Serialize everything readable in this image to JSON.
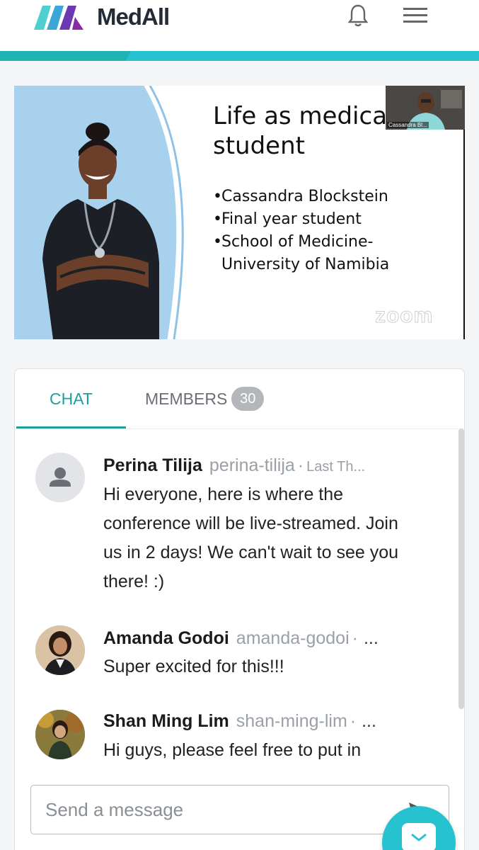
{
  "header": {
    "brand": "MedAll",
    "notifications_icon": "bell-icon",
    "menu_icon": "hamburger-menu-icon",
    "accent_color": "#27c2cf"
  },
  "video": {
    "slide_title": "Life as medical student",
    "slide_bullets": [
      "Cassandra Blockstein",
      "Final year student",
      "School of Medicine-",
      "University of Namibia"
    ],
    "pip_name": "Cassandra Bl...",
    "watermark": "zoom"
  },
  "tabs": {
    "chat_label": "CHAT",
    "members_label": "MEMBERS",
    "members_count": "30"
  },
  "messages": [
    {
      "name": "Perina Tilija",
      "handle": "perina-tilija",
      "time": "Last Th...",
      "text": "Hi everyone, here is where the conference will be live-streamed. Join us in 2 days! We can't wait to see you there! :)"
    },
    {
      "name": "Amanda Godoi",
      "handle": "amanda-godoi",
      "time": "...",
      "text": "Super excited for this!!!"
    },
    {
      "name": "Shan Ming Lim",
      "handle": "shan-ming-lim",
      "time": "...",
      "text": "Hi guys, please feel free to put in"
    }
  ],
  "composer": {
    "placeholder": "Send a message",
    "send_icon": "send-icon"
  },
  "fab_icon": "chat-bubble-icon"
}
